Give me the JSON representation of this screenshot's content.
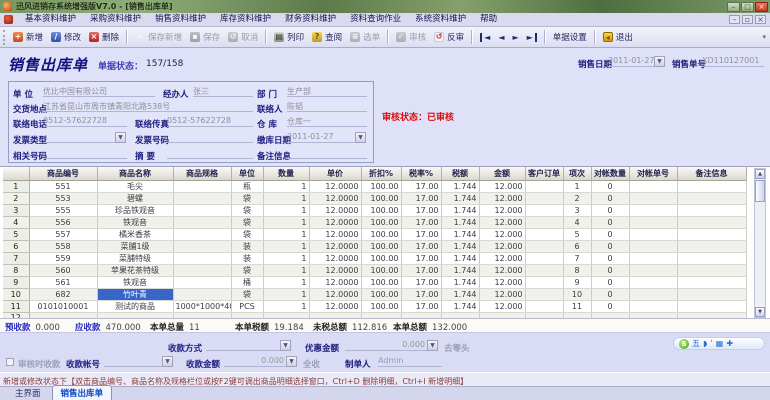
{
  "window": {
    "title": "迅风进销存系统增强版V7.0 - [销售出库单]",
    "controls": [
      "–",
      "□",
      "×"
    ],
    "mdi_controls": [
      "–",
      "▫",
      "×"
    ]
  },
  "menu": {
    "items": [
      "基本资料维护",
      "采购资料维护",
      "销售资料维护",
      "库存资料维护",
      "财务资料维护",
      "资料查询作业",
      "系统资料维护",
      "帮助"
    ]
  },
  "toolbar": {
    "buttons": [
      {
        "label": "新增",
        "icon": "add-icon",
        "glyph": "+",
        "enabled": true,
        "group_end": false
      },
      {
        "label": "修改",
        "icon": "edit-icon",
        "glyph": "∕",
        "enabled": true,
        "group_end": false
      },
      {
        "label": "删除",
        "icon": "delete-icon",
        "glyph": "×",
        "enabled": true,
        "group_end": true
      },
      {
        "label": "保存新增",
        "icon": "save-new-icon",
        "glyph": "+",
        "enabled": false,
        "group_end": false
      },
      {
        "label": "保存",
        "icon": "save-icon",
        "glyph": "▪",
        "enabled": false,
        "group_end": false
      },
      {
        "label": "取消",
        "icon": "cancel-icon",
        "glyph": "↺",
        "enabled": false,
        "group_end": true
      },
      {
        "label": "列印",
        "icon": "print-icon",
        "glyph": "▤",
        "enabled": true,
        "group_end": false
      },
      {
        "label": "查阅",
        "icon": "view-icon",
        "glyph": "?",
        "enabled": true,
        "group_end": false
      },
      {
        "label": "选单",
        "icon": "pick-icon",
        "glyph": "≡",
        "enabled": false,
        "group_end": true
      },
      {
        "label": "审核",
        "icon": "audit-icon",
        "glyph": "✓",
        "enabled": false,
        "group_end": false
      },
      {
        "label": "反审",
        "icon": "unaudit-icon",
        "glyph": "↺",
        "enabled": true,
        "group_end": true
      }
    ],
    "nav": [
      {
        "name": "first-record-button",
        "glyph": "◄",
        "edge": "left"
      },
      {
        "name": "prev-record-button",
        "glyph": "◄",
        "edge": ""
      },
      {
        "name": "next-record-button",
        "glyph": "►",
        "edge": ""
      },
      {
        "name": "last-record-button",
        "glyph": "►",
        "edge": "right"
      }
    ],
    "settings_label": "单据设置",
    "exit_label": "退出",
    "overflow_glyph": "▾"
  },
  "form": {
    "doc_title": "销售出库单",
    "state_label": "单据状态：",
    "state_value": "157/158",
    "sale_date_label": "销售日期",
    "sale_date": "2011-01-27",
    "sale_no_label": "销售单号",
    "sale_no": "XD110127001",
    "audit_status": "审核状态：已审核",
    "fields": {
      "unit": {
        "label": "单  位",
        "value": "优比中国有限公司"
      },
      "agent": {
        "label": "经办人",
        "value": "张三"
      },
      "dept": {
        "label": "部  门",
        "value": "生产部"
      },
      "address": {
        "label": "交货地点",
        "value": "江苏省昆山市周市镇青阳北路538号"
      },
      "contact": {
        "label": "联络人",
        "value": "陈韬"
      },
      "phone": {
        "label": "联络电话",
        "value": "0512-57622728"
      },
      "fax": {
        "label": "联络传真",
        "value": "0512-57622728"
      },
      "warehouse": {
        "label": "仓  库",
        "value": "仓库一"
      },
      "invoice_type": {
        "label": "发票类型",
        "value": ""
      },
      "invoice_no": {
        "label": "发票号码",
        "value": ""
      },
      "stock_date": {
        "label": "缴库日期",
        "value": "2011-01-27"
      },
      "related_no": {
        "label": "相关号码",
        "value": ""
      },
      "abstract": {
        "label": "摘  要",
        "value": ""
      },
      "note": {
        "label": "备注信息",
        "value": ""
      }
    }
  },
  "table": {
    "columns": [
      "",
      "商品编号",
      "商品名称",
      "商品规格",
      "单位",
      "数量",
      "单价",
      "折扣%",
      "税率%",
      "税额",
      "金额",
      "客户订单",
      "项次",
      "对帐数量",
      "对帐单号",
      "备注信息"
    ],
    "rows": [
      {
        "no": "1",
        "code": "551",
        "name": "毛尖",
        "spec": "",
        "unit": "瓶",
        "qty": "1",
        "price": "12.0000",
        "discount": "100.00",
        "tax_rate": "17.00",
        "tax": "1.744",
        "amount": "12.000",
        "cust_order": "",
        "seq": "1",
        "recon_qty": "0",
        "recon_no": "",
        "note": "",
        "selected": false
      },
      {
        "no": "2",
        "code": "553",
        "name": "碧螺",
        "spec": "",
        "unit": "袋",
        "qty": "1",
        "price": "12.0000",
        "discount": "100.00",
        "tax_rate": "17.00",
        "tax": "1.744",
        "amount": "12.000",
        "cust_order": "",
        "seq": "2",
        "recon_qty": "0",
        "recon_no": "",
        "note": "",
        "selected": false
      },
      {
        "no": "3",
        "code": "555",
        "name": "珍品铁观音",
        "spec": "",
        "unit": "袋",
        "qty": "1",
        "price": "12.0000",
        "discount": "100.00",
        "tax_rate": "17.00",
        "tax": "1.744",
        "amount": "12.000",
        "cust_order": "",
        "seq": "3",
        "recon_qty": "0",
        "recon_no": "",
        "note": "",
        "selected": false
      },
      {
        "no": "4",
        "code": "556",
        "name": "铁观音",
        "spec": "",
        "unit": "袋",
        "qty": "1",
        "price": "12.0000",
        "discount": "100.00",
        "tax_rate": "17.00",
        "tax": "1.744",
        "amount": "12.000",
        "cust_order": "",
        "seq": "4",
        "recon_qty": "0",
        "recon_no": "",
        "note": "",
        "selected": false
      },
      {
        "no": "5",
        "code": "557",
        "name": "橘米香茶",
        "spec": "",
        "unit": "袋",
        "qty": "1",
        "price": "12.0000",
        "discount": "100.00",
        "tax_rate": "17.00",
        "tax": "1.744",
        "amount": "12.000",
        "cust_order": "",
        "seq": "5",
        "recon_qty": "0",
        "recon_no": "",
        "note": "",
        "selected": false
      },
      {
        "no": "6",
        "code": "558",
        "name": "菜脯1级",
        "spec": "",
        "unit": "装",
        "qty": "1",
        "price": "12.0000",
        "discount": "100.00",
        "tax_rate": "17.00",
        "tax": "1.744",
        "amount": "12.000",
        "cust_order": "",
        "seq": "6",
        "recon_qty": "0",
        "recon_no": "",
        "note": "",
        "selected": false
      },
      {
        "no": "7",
        "code": "559",
        "name": "菜脯特级",
        "spec": "",
        "unit": "装",
        "qty": "1",
        "price": "12.0000",
        "discount": "100.00",
        "tax_rate": "17.00",
        "tax": "1.744",
        "amount": "12.000",
        "cust_order": "",
        "seq": "7",
        "recon_qty": "0",
        "recon_no": "",
        "note": "",
        "selected": false
      },
      {
        "no": "8",
        "code": "560",
        "name": "苹果花茶特级",
        "spec": "",
        "unit": "袋",
        "qty": "1",
        "price": "12.0000",
        "discount": "100.00",
        "tax_rate": "17.00",
        "tax": "1.744",
        "amount": "12.000",
        "cust_order": "",
        "seq": "8",
        "recon_qty": "0",
        "recon_no": "",
        "note": "",
        "selected": false
      },
      {
        "no": "9",
        "code": "561",
        "name": "铁观音",
        "spec": "",
        "unit": "桶",
        "qty": "1",
        "price": "12.0000",
        "discount": "100.00",
        "tax_rate": "17.00",
        "tax": "1.744",
        "amount": "12.000",
        "cust_order": "",
        "seq": "9",
        "recon_qty": "0",
        "recon_no": "",
        "note": "",
        "selected": false
      },
      {
        "no": "10",
        "code": "682",
        "name": "竹叶青",
        "spec": "",
        "unit": "袋",
        "qty": "1",
        "price": "12.0000",
        "discount": "100.00",
        "tax_rate": "17.00",
        "tax": "1.744",
        "amount": "12.000",
        "cust_order": "",
        "seq": "10",
        "recon_qty": "0",
        "recon_no": "",
        "note": "",
        "selected": true
      },
      {
        "no": "11",
        "code": "0101010001",
        "name": "测试的商品",
        "spec": "1000*1000*40.",
        "unit": "PCS",
        "qty": "1",
        "price": "12.0000",
        "discount": "100.00",
        "tax_rate": "17.00",
        "tax": "1.744",
        "amount": "12.000",
        "cust_order": "",
        "seq": "11",
        "recon_qty": "0",
        "recon_no": "",
        "note": "",
        "selected": false
      },
      {
        "no": "12",
        "code": "",
        "name": "",
        "spec": "",
        "unit": "",
        "qty": "",
        "price": "",
        "discount": "",
        "tax_rate": "",
        "tax": "",
        "amount": "",
        "cust_order": "",
        "seq": "",
        "recon_qty": "",
        "recon_no": "",
        "note": "",
        "selected": false
      }
    ]
  },
  "summary": {
    "items": [
      {
        "label": "预收款",
        "value": "0.000",
        "accent": true
      },
      {
        "label": "应收款",
        "value": "470.000",
        "accent": true
      },
      {
        "label": "本单总量",
        "value": "11",
        "accent": false
      },
      {
        "label": "本单税额",
        "value": "19.184",
        "accent": false
      },
      {
        "label": "未税总额",
        "value": "112.816",
        "accent": false
      },
      {
        "label": "本单总额",
        "value": "132.000",
        "accent": false
      }
    ]
  },
  "payment": {
    "method_label": "收款方式",
    "discount_label": "优惠金额",
    "discount_value": "0.000",
    "rounding_label": "去零头",
    "audit_collect_label": "审核时收款",
    "account_label": "收款帐号",
    "amount_label": "收款金额",
    "amount_value": "0.000",
    "collect_all_label": "全收",
    "maker_label": "制单人",
    "maker_value": "Admin"
  },
  "ime": {
    "icons": [
      {
        "name": "sogou-logo-icon",
        "glyph": "S",
        "logo": true
      },
      {
        "name": "wubi-mode-icon",
        "glyph": "五",
        "logo": false
      },
      {
        "name": "fullhalf-mode-icon",
        "glyph": "◗",
        "logo": false
      },
      {
        "name": "punctuation-mode-icon",
        "glyph": "’",
        "logo": false
      },
      {
        "name": "soft-keyboard-icon",
        "glyph": "▦",
        "logo": false
      },
      {
        "name": "toolbox-icon",
        "glyph": "✚",
        "logo": false
      }
    ]
  },
  "hint": {
    "text": "新增或修改状态下【双击商品编号、商品名称及规格栏位或按F2键可调出商品明细选择窗口，Ctrl+D 删除明细，Ctrl+I 新增明细】"
  },
  "tabs": [
    {
      "label": "主界面",
      "active": false
    },
    {
      "label": "销售出库单",
      "active": true
    }
  ],
  "colors": {
    "accent_red": "#d80f0f",
    "selection_blue": "#3865c8",
    "label_navy": "#1c1c7e"
  }
}
